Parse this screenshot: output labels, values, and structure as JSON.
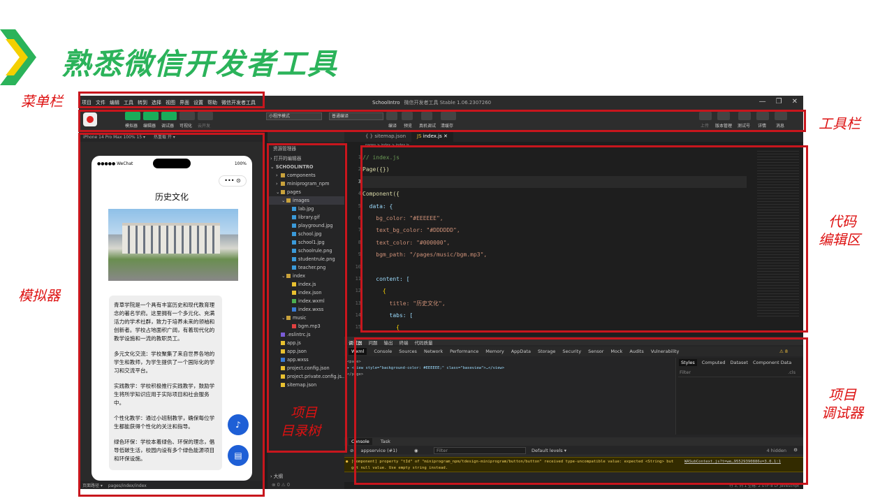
{
  "slide": {
    "title": "熟悉微信开发者工具",
    "labels": {
      "menubar": "菜单栏",
      "toolbar": "工具栏",
      "simulator": "模拟器",
      "code_editor_1": "代码",
      "code_editor_2": "编辑区",
      "tree_1": "项目",
      "tree_2": "目录树",
      "debugger_1": "项目",
      "debugger_2": "调试器"
    }
  },
  "menu": [
    "项目",
    "文件",
    "编辑",
    "工具",
    "转到",
    "选择",
    "视图",
    "界面",
    "设置",
    "帮助",
    "微信开发者工具"
  ],
  "window": {
    "project": "SchoolIntro",
    "title": "微信开发者工具 Stable 1.06.2307260"
  },
  "toolbar": {
    "buttons": [
      "模拟器",
      "编辑器",
      "调试器",
      "可视化",
      "云开发"
    ],
    "mode": "小程序模式",
    "compile": "普通编译",
    "actions": [
      "编译",
      "预览",
      "真机调试",
      "清缓存"
    ],
    "right": [
      "上传",
      "版本管理",
      "测试号",
      "详情",
      "消息"
    ]
  },
  "simulator": {
    "device": "iPhone 14 Pro Max 100% 15 ▾",
    "hotreload": "热重载 开 ▾",
    "carrier": "●●●●● WeChat",
    "battery": "100%",
    "capsule": "•••  ⊙",
    "page_title": "历史文化",
    "paragraphs": [
      "青草学院是一个具有丰富历史和现代教育理念的著名学府。这里拥有一个多元化、充满活力的学术社群，致力于培养未来的领袖和创新者。学校占地面积广阔，有着现代化的教学设施和一流的教职员工。",
      "多元文化交流：学校聚集了来自世界各地的学生和教师，为学生提供了一个国际化的学习和交流平台。",
      "实践教学：学校积极推行实践教学，鼓励学生将所学知识应用于实际项目和社会服务中。",
      "个性化教学：通过小班制教学，确保每位学生都能获得个性化的关注和指导。",
      "绿色环保：学校本着绿色、环保的理念，倡导低碳生活，校园内设有多个绿色能源项目和环保设施。"
    ],
    "path_label": "页面路径 ▾",
    "path": "pages/index/index"
  },
  "explorer": {
    "header": "资源管理器",
    "open_editors": "打开的编辑器",
    "root": "SCHOOLINTRO",
    "outline": "大纲",
    "problems": "⊗ 0 ⚠ 0",
    "items": [
      {
        "name": "components",
        "indent": 1,
        "kind": "folder",
        "arrow": "›"
      },
      {
        "name": "miniprogram_npm",
        "indent": 1,
        "kind": "folder",
        "arrow": "›"
      },
      {
        "name": "pages",
        "indent": 1,
        "kind": "folder-open",
        "arrow": "⌄"
      },
      {
        "name": "images",
        "indent": 2,
        "kind": "folder-open",
        "arrow": "⌄"
      },
      {
        "name": "lab.jpg",
        "indent": 3,
        "kind": "img"
      },
      {
        "name": "library.gif",
        "indent": 3,
        "kind": "img"
      },
      {
        "name": "playground.jpg",
        "indent": 3,
        "kind": "img"
      },
      {
        "name": "school.jpg",
        "indent": 3,
        "kind": "img"
      },
      {
        "name": "school1.jpg",
        "indent": 3,
        "kind": "img"
      },
      {
        "name": "schoolrule.png",
        "indent": 3,
        "kind": "img"
      },
      {
        "name": "studentrule.png",
        "indent": 3,
        "kind": "img"
      },
      {
        "name": "teacher.png",
        "indent": 3,
        "kind": "img"
      },
      {
        "name": "index",
        "indent": 2,
        "kind": "folder-open",
        "arrow": "⌄"
      },
      {
        "name": "index.js",
        "indent": 3,
        "kind": "js"
      },
      {
        "name": "index.json",
        "indent": 3,
        "kind": "json"
      },
      {
        "name": "index.wxml",
        "indent": 3,
        "kind": "wxml"
      },
      {
        "name": "index.wxss",
        "indent": 3,
        "kind": "wxss"
      },
      {
        "name": "music",
        "indent": 2,
        "kind": "folder-open",
        "arrow": "⌄"
      },
      {
        "name": "bgm.mp3",
        "indent": 3,
        "kind": "mp3"
      },
      {
        "name": ".eslintrc.js",
        "indent": 1,
        "kind": "eslint"
      },
      {
        "name": "app.js",
        "indent": 1,
        "kind": "js"
      },
      {
        "name": "app.json",
        "indent": 1,
        "kind": "json"
      },
      {
        "name": "app.wxss",
        "indent": 1,
        "kind": "wxss"
      },
      {
        "name": "project.config.json",
        "indent": 1,
        "kind": "json"
      },
      {
        "name": "project.private.config.js...",
        "indent": 1,
        "kind": "json"
      },
      {
        "name": "sitemap.json",
        "indent": 1,
        "kind": "json"
      }
    ]
  },
  "editor": {
    "tabs": [
      "sitemap.json",
      "index.js"
    ],
    "breadcrumb": "pages > index > index.js",
    "lines": [
      {
        "n": "1",
        "t": "// index.js",
        "c": "cm"
      },
      {
        "n": "2",
        "t": "Page({})",
        "c": "kw"
      },
      {
        "n": "3",
        "t": "",
        "c": "hl"
      },
      {
        "n": "4",
        "t": "Component({",
        "c": "kw"
      },
      {
        "n": "5",
        "t": "  data: {",
        "c": "pr"
      },
      {
        "n": "6",
        "t": "    bg_color: \"#EEEEEE\",",
        "c": "st"
      },
      {
        "n": "7",
        "t": "    text_bg_color: \"#DDDDDD\",",
        "c": "st"
      },
      {
        "n": "8",
        "t": "    text_color: \"#000000\",",
        "c": "st"
      },
      {
        "n": "9",
        "t": "    bgm_path: \"/pages/music/bgm.mp3\",",
        "c": "st"
      },
      {
        "n": "10",
        "t": "",
        "c": ""
      },
      {
        "n": "11",
        "t": "    content: [",
        "c": "pr"
      },
      {
        "n": "12",
        "t": "      {",
        "c": "bk"
      },
      {
        "n": "13",
        "t": "        title: \"历史文化\",",
        "c": "st"
      },
      {
        "n": "14",
        "t": "        tabs: [",
        "c": "pr"
      },
      {
        "n": "15",
        "t": "          {",
        "c": "bk"
      }
    ]
  },
  "debugger": {
    "tabs": [
      "调试器",
      "问题",
      "输出",
      "终端",
      "代码质量"
    ],
    "panels": [
      "Wxml",
      "Console",
      "Sources",
      "Network",
      "Performance",
      "Memory",
      "AppData",
      "Storage",
      "Security",
      "Sensor",
      "Mock",
      "Audits",
      "Vulnerability"
    ],
    "warnings": "⚠ 8",
    "dom_lines": [
      "<page>",
      "▸ <view style=\"background-color: #EEEEEE;\" class=\"baseview\">…</view>",
      "</page>"
    ],
    "style_tabs": [
      "Styles",
      "Computed",
      "Dataset",
      "Component Data"
    ],
    "style_filter": "Filter",
    "cls": ".cls",
    "console_tabs": [
      "Console",
      "Task"
    ],
    "context": "appservice (#1)",
    "filter": "Filter",
    "levels": "Default levels ▾",
    "hidden": "4 hidden",
    "warning_text": "[Component] property \"tId\" of \"miniprogram_npm/tdesign-miniprogram/button/button\" received type-uncompatible value: expected <String> but get null value. Use empty string instead.",
    "warning_link": "WASubContext.js?t=we…95529390886v=3.0.1:1",
    "status": "行 3, 列 1   空格: 2   UTF-8   LF   JavaScript"
  }
}
